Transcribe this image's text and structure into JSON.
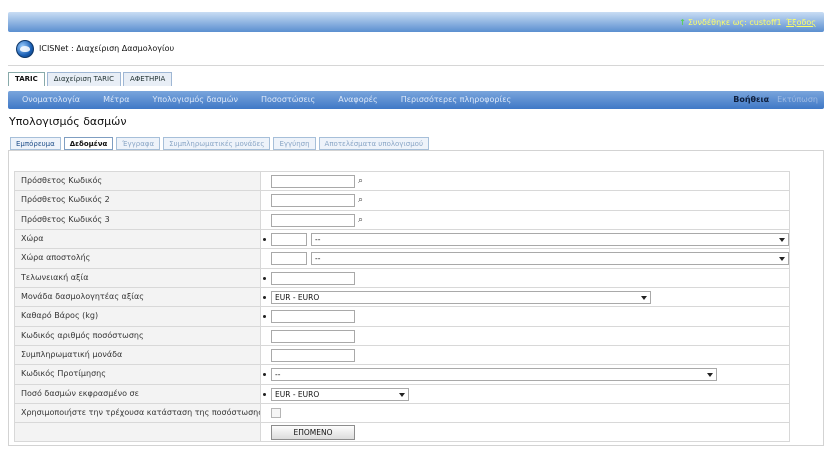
{
  "header": {
    "user_text": "Συνδέθηκε ως: custoff1",
    "logout_label": "Έξοδος",
    "app_title": "ICISNet : Διαχείριση Δασμολογίου"
  },
  "top_tabs": [
    {
      "label": "TARIC",
      "active": true
    },
    {
      "label": "Διαχείριση TARIC",
      "active": false
    },
    {
      "label": "ΑΦΕΤΗΡΙΑ",
      "active": false
    }
  ],
  "nav": {
    "items": [
      "Ονοματολογία",
      "Μέτρα",
      "Υπολογισμός δασμών",
      "Ποσοστώσεις",
      "Αναφορές",
      "Περισσότερες πληροφορίες"
    ],
    "help": "Βοήθεια",
    "print": "Εκτύπωση"
  },
  "page_title": "Υπολογισμός δασμών",
  "content_tabs": [
    {
      "label": "Εμπόρευμα",
      "active": false
    },
    {
      "label": "Δεδομένα",
      "active": true
    },
    {
      "label": "Έγγραφα",
      "active": false
    },
    {
      "label": "Συμπληρωματικές μονάδες",
      "active": false
    },
    {
      "label": "Εγγύηση",
      "active": false
    },
    {
      "label": "Αποτελέσματα υπολογισμού",
      "active": false
    }
  ],
  "form": {
    "additional_code": "Πρόσθετος Κωδικός",
    "additional_code_2": "Πρόσθετος Κωδικός 2",
    "additional_code_3": "Πρόσθετος Κωδικός 3",
    "country": "Χώρα",
    "country_value": "--",
    "dispatch_country": "Χώρα αποστολής",
    "dispatch_country_value": "--",
    "customs_value": "Τελωνειακή αξία",
    "currency_unit": "Μονάδα δασμολογητέας αξίας",
    "currency_unit_value": "EUR - EURO",
    "net_weight": "Καθαρό Βάρος (kg)",
    "quota_order_number": "Κωδικός αριθμός ποσόστωσης",
    "supplementary_unit": "Συμπληρωματική μονάδα",
    "preference_code": "Κωδικός Προτίμησης",
    "preference_code_value": "--",
    "duty_amount_currency": "Ποσό δασμών εκφρασμένο σε",
    "duty_amount_currency_value": "EUR - EURO",
    "use_quota_status": "Χρησιμοποιήστε την τρέχουσα κατάσταση της ποσόστωσης",
    "next_button": "ΕΠΟΜΕΝΟ"
  }
}
